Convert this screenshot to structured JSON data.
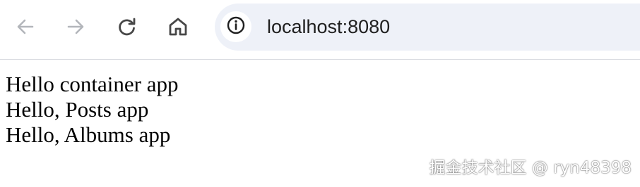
{
  "browser": {
    "url": "localhost:8080",
    "icons": {
      "back": "arrow-left-icon",
      "forward": "arrow-right-icon",
      "reload": "reload-icon",
      "home": "home-icon",
      "site_info": "info-icon"
    },
    "colors": {
      "disabled_icon": "#b3b6bb",
      "active_icon": "#474747",
      "omnibox_bg": "#eef1f8"
    }
  },
  "page": {
    "lines": [
      "Hello container app",
      "Hello, Posts app",
      "Hello, Albums app"
    ]
  },
  "watermark": "掘金技术社区 @ ryn48398"
}
